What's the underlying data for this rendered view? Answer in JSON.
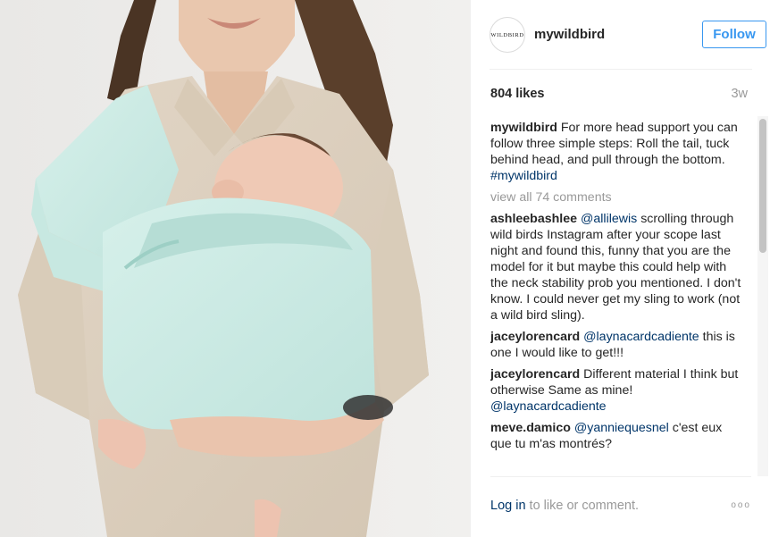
{
  "post": {
    "username": "mywildbird",
    "avatar_text": "WILDBIRD",
    "follow_label": "Follow",
    "likes": "804 likes",
    "age": "3w"
  },
  "caption": {
    "author": "mywildbird",
    "text": "For more head support you can follow three simple steps: Roll the tail, tuck behind head, and pull through the bottom. ",
    "hashtag": "#mywildbird"
  },
  "view_all": "view all 74 comments",
  "comments": [
    {
      "author": "ashleebashlee",
      "mention": "@allilewis",
      "text": " scrolling through wild birds Instagram after your scope last night and found this, funny that you are the model for it but maybe this could help with the neck stability prob you mentioned. I don't know. I could never get my sling to work (not a wild bird sling)."
    },
    {
      "author": "jaceylorencard",
      "mention": "@laynacardcadiente",
      "text": " this is one I would like to get!!!"
    },
    {
      "author": "jaceylorencard",
      "text": "Different material I think but otherwise Same as mine! ",
      "mention_end": "@laynacardcadiente"
    },
    {
      "author": "meve.damico",
      "mention": "@yanniequesnel",
      "text": " c'est eux que tu m'as montrés?"
    }
  ],
  "footer": {
    "login": "Log in",
    "login_rest": " to like or comment.",
    "more": "ooo"
  },
  "colors": {
    "accent": "#3897f0",
    "link": "#003569",
    "muted": "#999999",
    "sling": "#cfece6"
  }
}
